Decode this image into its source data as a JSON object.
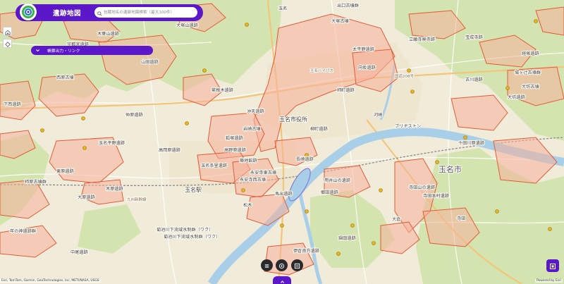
{
  "app": {
    "title": "遺跡地図"
  },
  "search": {
    "placeholder": "包蔵地名の遺跡地図検索（最大100件）"
  },
  "layer_panel": {
    "label": "帳票出力・リンク"
  },
  "map": {
    "city_label": "玉名市",
    "area_labels": {
      "pref_office": "玉名市役所",
      "briston": "ブリヂストン",
      "tamana_station": "玉名駅",
      "tamana_ekimae": "玉名",
      "kawasaki": "河崎",
      "matsugi": "松木",
      "ohkura": "大倉",
      "teramachi": "寺田"
    },
    "site_labels": [
      "出口古墳群",
      "大塚古墳",
      "大塚山遺跡",
      "木葉山遺跡",
      "仲原遺跡",
      "東原遺跡",
      "太平野遺跡",
      "向坂遺跡",
      "用井山の遺跡",
      "郷田遺跡",
      "柿町遺跡",
      "柳町遺跡",
      "高野原遺跡",
      "狐塚遺跡",
      "築地館跡",
      "玉名条里遺跡",
      "菊池川下流域水制群（ワク）",
      "菊池川下流域水制群（ワク）",
      "大坊古墳",
      "城ヶ辻古墳群",
      "永安寺東古墳",
      "永安寺西古墳",
      "馬出遺跡",
      "伊倉南方遺跡",
      "長崎遺跡",
      "沖天遺跡",
      "立願寺廃寺跡",
      "岩崎古墳",
      "大坊遺跡",
      "古川遺跡",
      "年の神遺跡群",
      "下西遺跡",
      "山田遺跡",
      "西原古墳",
      "千田川原遺跡",
      "寺田山の遺跡",
      "寺田本村遺跡",
      "経塚遺跡",
      "高岡原遺跡",
      "宇都宮遺跡",
      "鍋田遺跡",
      "宝成寺跡",
      "大原遺跡",
      "柿原古墳群",
      "木原遺跡",
      "繁根木遺跡",
      "玉名平野遺跡",
      "中尾遺跡"
    ],
    "road_labels": [
      "国道208号",
      "玉名バイパス",
      "九州新幹線"
    ]
  },
  "attribution": "Esri, TomTom, Garmin, GeoTechnologies, Inc, METI/NASA, USGS",
  "powered_by": "Powered by Esri",
  "colors": {
    "brand": "#5b18c9",
    "site_fill": "#f5b09a",
    "site_stroke": "#e35a3a",
    "river": "#a9cfe8",
    "forest": "#cfe3a8",
    "base": "#f1ecd9",
    "marker": "#e9b51a"
  },
  "icons": {
    "logo": "app-logo-icon",
    "search": "search-icon",
    "home": "home-icon",
    "locate": "locate-icon",
    "layer_chevron": "chevron-down-icon",
    "bottom_left": "layers-icon",
    "bottom_mid": "basemap-icon",
    "bottom_right": "print-icon",
    "bottom_tab": "chevron-up-icon",
    "corner": "legend-icon"
  }
}
